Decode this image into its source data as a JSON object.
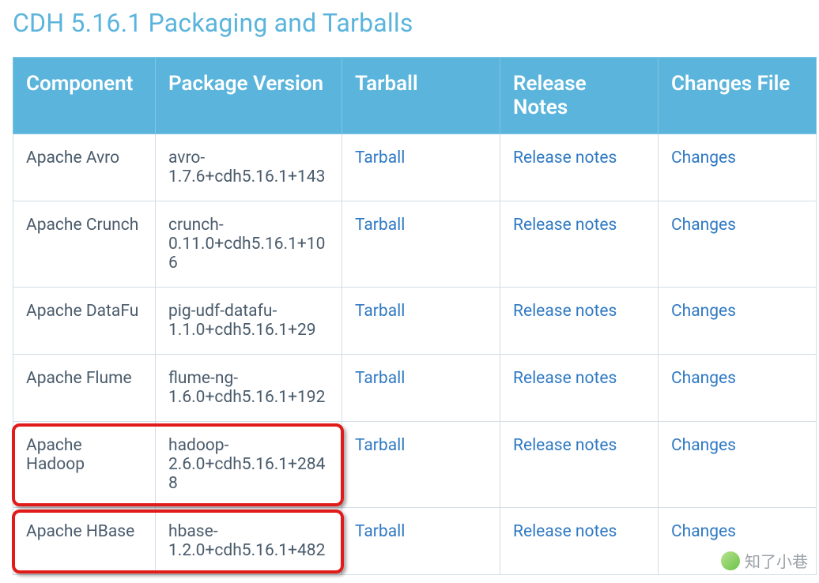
{
  "title": "CDH 5.16.1 Packaging and Tarballs",
  "headers": {
    "component": "Component",
    "package_version": "Package Version",
    "tarball": "Tarball",
    "release_notes": "Release Notes",
    "changes_file": "Changes File"
  },
  "links": {
    "tarball": "Tarball",
    "release_notes": "Release notes",
    "changes": "Changes"
  },
  "rows": [
    {
      "component": "Apache Avro",
      "package": "avro-1.7.6+cdh5.16.1+143",
      "highlighted": false
    },
    {
      "component": "Apache Crunch",
      "package": "crunch-0.11.0+cdh5.16.1+106",
      "highlighted": false
    },
    {
      "component": "Apache DataFu",
      "package": "pig-udf-datafu-1.1.0+cdh5.16.1+29",
      "highlighted": false
    },
    {
      "component": "Apache Flume",
      "package": "flume-ng-1.6.0+cdh5.16.1+192",
      "highlighted": false
    },
    {
      "component": "Apache Hadoop",
      "package": "hadoop-2.6.0+cdh5.16.1+2848",
      "highlighted": true
    },
    {
      "component": "Apache HBase",
      "package": "hbase-1.2.0+cdh5.16.1+482",
      "highlighted": true
    }
  ],
  "watermark": "知了小巷"
}
